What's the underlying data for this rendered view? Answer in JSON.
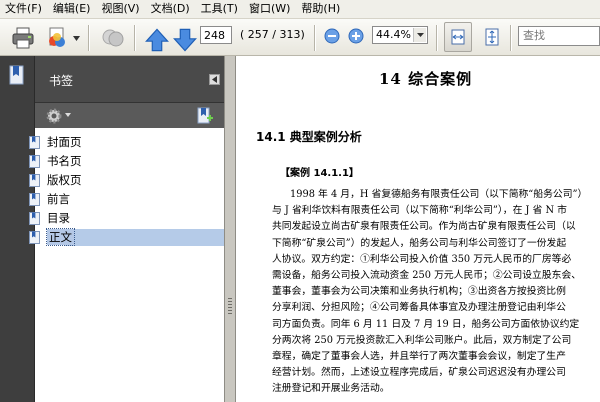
{
  "menu": [
    "文件(F)",
    "编辑(E)",
    "视图(V)",
    "文档(D)",
    "工具(T)",
    "窗口(W)",
    "帮助(H)"
  ],
  "toolbar": {
    "page_current": "248",
    "page_count": "( 257 / 313)",
    "zoom": "44.4%",
    "search_placeholder": "查找"
  },
  "bookmarks": {
    "title": "书签",
    "items": [
      "封面页",
      "书名页",
      "版权页",
      "前言",
      "目录",
      "正文"
    ],
    "selected": "正文"
  },
  "document": {
    "chapter_title": "14   综合案例",
    "section_title": "14.1   典型案例分析",
    "case_label": "【案例 14.1.1】",
    "lines": [
      "1998 年 4 月，H 省复德船务有限责任公司（以下简称“船务公司”）",
      "与 J 省利华饮料有限责任公司（以下简称“利华公司”），在 J 省 N 市",
      "共同发起设立尚古矿泉有限责任公司。作为尚古矿泉有限责任公司（以",
      "下简称“矿泉公司”）的发起人，船务公司与利华公司签订了一份发起",
      "人协议。双方约定：①利华公司投入价值 350 万元人民币的厂房等必",
      "需设备，船务公司投入流动资金 250 万元人民币；②公司设立股东会、",
      "董事会，董事会为公司决策和业务执行机构；③出资各方按投资比例",
      "分享利润、分担风险；④公司筹备具体事宜及办理注册登记由利华公",
      "司方面负责。同年 6 月 11 日及 7 月 19 日，船务公司方面依协议约定",
      "分两次将 250 万元投资款汇入利华公司账户。此后，双方制定了公司",
      "章程，确定了董事会人选，并且举行了两次董事会会议，制定了生产",
      "经营计划。然而，上述设立程序完成后，矿泉公司迟迟没有办理公司",
      "注册登记和开展业务活动。"
    ]
  }
}
